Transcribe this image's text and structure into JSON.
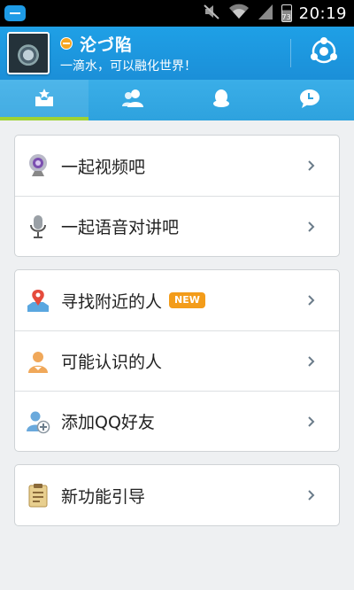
{
  "status_bar": {
    "time": "20:19",
    "battery": "73",
    "icons": [
      "app-notification-icon",
      "mute-icon",
      "wifi-icon",
      "signal-icon",
      "battery-icon"
    ]
  },
  "header": {
    "username": "沦づ陷",
    "signature": "一滴水，可以融化世界！",
    "status": "away",
    "status_color": "#f6a623",
    "action_icon": "qzone-icon"
  },
  "tabs": [
    {
      "name": "discover",
      "icon": "inbox-star-icon",
      "active": true
    },
    {
      "name": "contacts",
      "icon": "contacts-icon",
      "active": false
    },
    {
      "name": "qq",
      "icon": "penguin-icon",
      "active": false
    },
    {
      "name": "messages",
      "icon": "chat-bubble-icon",
      "active": false
    }
  ],
  "groups": [
    {
      "items": [
        {
          "label": "一起视频吧",
          "icon": "webcam-icon"
        },
        {
          "label": "一起语音对讲吧",
          "icon": "microphone-icon"
        }
      ]
    },
    {
      "items": [
        {
          "label": "寻找附近的人",
          "icon": "map-pin-icon",
          "badge": "NEW"
        },
        {
          "label": "可能认识的人",
          "icon": "person-icon"
        },
        {
          "label": "添加QQ好友",
          "icon": "add-friend-icon"
        }
      ]
    },
    {
      "items": [
        {
          "label": "新功能引导",
          "icon": "clipboard-icon"
        }
      ]
    }
  ],
  "colors": {
    "header": "#1b8fd8",
    "tab_indicator": "#9ed334",
    "badge": "#f39c1a",
    "chevron": "#6b7c8a"
  }
}
